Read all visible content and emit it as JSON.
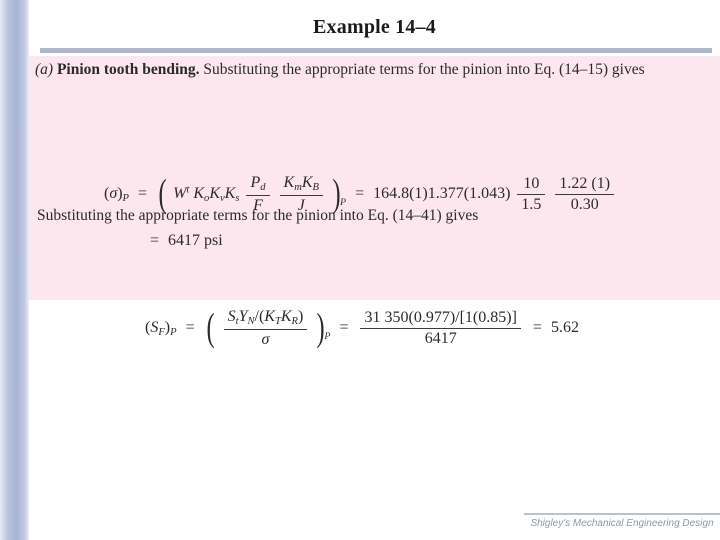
{
  "slide": {
    "title": "Example 14–4",
    "footer": "Shigley's Mechanical Engineering Design",
    "accent_color": "#aeb6ce",
    "content_bg": "#fce7ef",
    "band_color": "#a8b3d6"
  },
  "body": {
    "part_label": "(a)",
    "part_heading": "Pinion tooth bending.",
    "paragraph_1_rest": " Substituting the appropriate terms for the pinion into Eq. (14–15) gives",
    "paragraph_2": "Substituting the appropriate terms for the pinion into Eq. (14–41) gives"
  },
  "equation_1": {
    "lhs_symbol": "σ",
    "lhs_open": "(",
    "lhs_close": ")",
    "lhs_subscript": "P",
    "equals": "=",
    "factor_Wt": "W",
    "factor_Wt_sup": "t",
    "factor_Ko": "K",
    "factor_Ko_sub": "o",
    "factor_Kv": "K",
    "factor_Kv_sub": "v",
    "factor_Ks": "K",
    "factor_Ks_sub": "s",
    "frac1_num": "P",
    "frac1_num_sub": "d",
    "frac1_den": "F",
    "frac2_num_a": "K",
    "frac2_num_a_sub": "m",
    "frac2_num_b": "K",
    "frac2_num_b_sub": "B",
    "frac2_den": "J",
    "group_subscript": "P",
    "equals2": "=",
    "numeric_terms": "164.8(1)1.377(1.043)",
    "frac3_num": "10",
    "frac3_den": "1.5",
    "frac4_num": "1.22 (1)",
    "frac4_den": "0.30",
    "result_equals": "=",
    "result_value": "6417 psi"
  },
  "equation_2": {
    "lhs_symbol": "S",
    "lhs_symbol_sub": "F",
    "lhs_subscript": "P",
    "equals": "=",
    "num_St": "S",
    "num_St_sub": "t",
    "num_YN": "Y",
    "num_YN_sub": "N",
    "num_slash": "/(",
    "num_KT": "K",
    "num_KT_sub": "T",
    "num_KR": "K",
    "num_KR_sub": "R",
    "num_close": ")",
    "den_sigma": "σ",
    "group_subscript": "P",
    "equals2": "=",
    "frac_num": "31 350(0.977)/[1(0.85)]",
    "frac_den": "6417",
    "result_equals": "=",
    "result_value": "5.62"
  }
}
